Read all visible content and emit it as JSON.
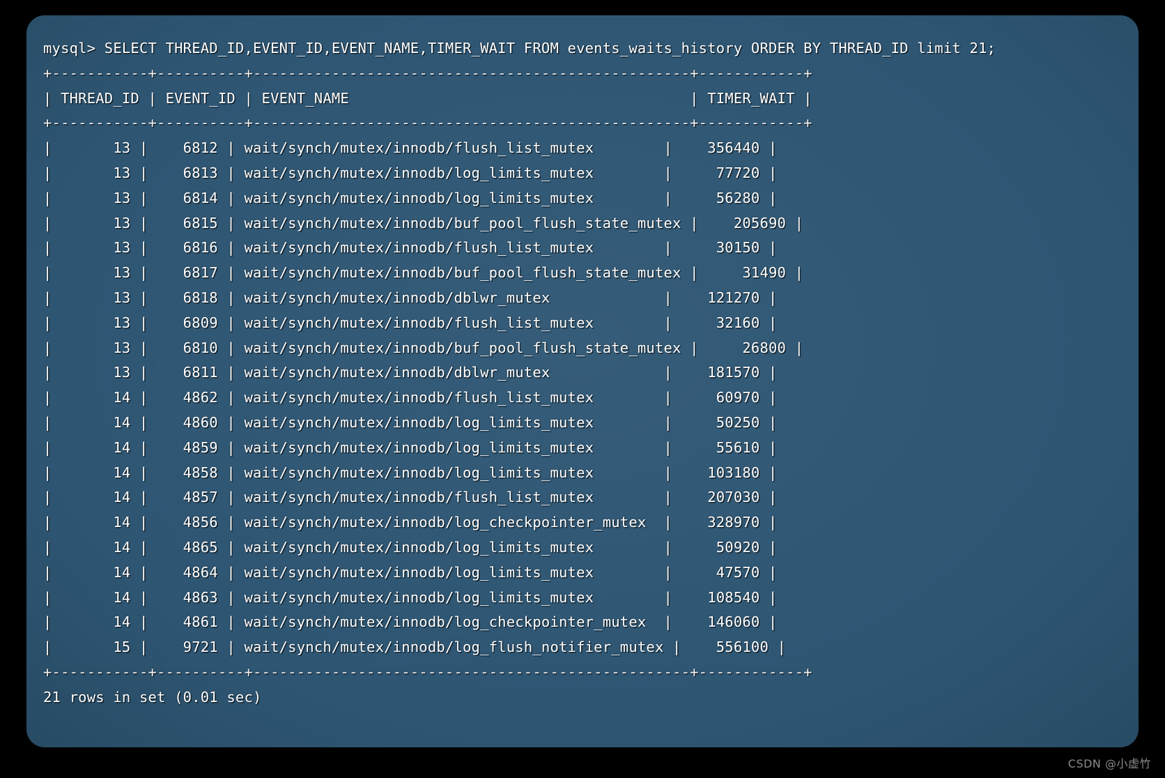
{
  "terminal": {
    "prompt": "mysql> ",
    "command": "SELECT THREAD_ID,EVENT_ID,EVENT_NAME,TIMER_WAIT FROM events_waits_history ORDER BY THREAD_ID limit 21;",
    "prompt_line": "mysql> SELECT THREAD_ID,EVENT_ID,EVENT_NAME,TIMER_WAIT FROM events_waits_history ORDER BY THREAD_ID limit 21;",
    "separator": "+-----------+----------+--------------------------------------------------+------------+",
    "header_line": "| THREAD_ID | EVENT_ID | EVENT_NAME                                       | TIMER_WAIT |",
    "footer_status": "21 rows in set (0.01 sec)",
    "watermark": "CSDN @小虚竹",
    "colors": {
      "background": "#000000",
      "window": "#2e5673",
      "text": "#ffffff",
      "watermark": "#8b8b8b"
    }
  },
  "table": {
    "columns": [
      "THREAD_ID",
      "EVENT_ID",
      "EVENT_NAME",
      "TIMER_WAIT"
    ],
    "rows": [
      {
        "THREAD_ID": "13",
        "EVENT_ID": "6812",
        "EVENT_NAME": "wait/synch/mutex/innodb/flush_list_mutex",
        "TIMER_WAIT": "356440"
      },
      {
        "THREAD_ID": "13",
        "EVENT_ID": "6813",
        "EVENT_NAME": "wait/synch/mutex/innodb/log_limits_mutex",
        "TIMER_WAIT": "77720"
      },
      {
        "THREAD_ID": "13",
        "EVENT_ID": "6814",
        "EVENT_NAME": "wait/synch/mutex/innodb/log_limits_mutex",
        "TIMER_WAIT": "56280"
      },
      {
        "THREAD_ID": "13",
        "EVENT_ID": "6815",
        "EVENT_NAME": "wait/synch/mutex/innodb/buf_pool_flush_state_mutex",
        "TIMER_WAIT": "205690"
      },
      {
        "THREAD_ID": "13",
        "EVENT_ID": "6816",
        "EVENT_NAME": "wait/synch/mutex/innodb/flush_list_mutex",
        "TIMER_WAIT": "30150"
      },
      {
        "THREAD_ID": "13",
        "EVENT_ID": "6817",
        "EVENT_NAME": "wait/synch/mutex/innodb/buf_pool_flush_state_mutex",
        "TIMER_WAIT": "31490"
      },
      {
        "THREAD_ID": "13",
        "EVENT_ID": "6818",
        "EVENT_NAME": "wait/synch/mutex/innodb/dblwr_mutex",
        "TIMER_WAIT": "121270"
      },
      {
        "THREAD_ID": "13",
        "EVENT_ID": "6809",
        "EVENT_NAME": "wait/synch/mutex/innodb/flush_list_mutex",
        "TIMER_WAIT": "32160"
      },
      {
        "THREAD_ID": "13",
        "EVENT_ID": "6810",
        "EVENT_NAME": "wait/synch/mutex/innodb/buf_pool_flush_state_mutex",
        "TIMER_WAIT": "26800"
      },
      {
        "THREAD_ID": "13",
        "EVENT_ID": "6811",
        "EVENT_NAME": "wait/synch/mutex/innodb/dblwr_mutex",
        "TIMER_WAIT": "181570"
      },
      {
        "THREAD_ID": "14",
        "EVENT_ID": "4862",
        "EVENT_NAME": "wait/synch/mutex/innodb/flush_list_mutex",
        "TIMER_WAIT": "60970"
      },
      {
        "THREAD_ID": "14",
        "EVENT_ID": "4860",
        "EVENT_NAME": "wait/synch/mutex/innodb/log_limits_mutex",
        "TIMER_WAIT": "50250"
      },
      {
        "THREAD_ID": "14",
        "EVENT_ID": "4859",
        "EVENT_NAME": "wait/synch/mutex/innodb/log_limits_mutex",
        "TIMER_WAIT": "55610"
      },
      {
        "THREAD_ID": "14",
        "EVENT_ID": "4858",
        "EVENT_NAME": "wait/synch/mutex/innodb/log_limits_mutex",
        "TIMER_WAIT": "103180"
      },
      {
        "THREAD_ID": "14",
        "EVENT_ID": "4857",
        "EVENT_NAME": "wait/synch/mutex/innodb/flush_list_mutex",
        "TIMER_WAIT": "207030"
      },
      {
        "THREAD_ID": "14",
        "EVENT_ID": "4856",
        "EVENT_NAME": "wait/synch/mutex/innodb/log_checkpointer_mutex",
        "TIMER_WAIT": "328970"
      },
      {
        "THREAD_ID": "14",
        "EVENT_ID": "4865",
        "EVENT_NAME": "wait/synch/mutex/innodb/log_limits_mutex",
        "TIMER_WAIT": "50920"
      },
      {
        "THREAD_ID": "14",
        "EVENT_ID": "4864",
        "EVENT_NAME": "wait/synch/mutex/innodb/log_limits_mutex",
        "TIMER_WAIT": "47570"
      },
      {
        "THREAD_ID": "14",
        "EVENT_ID": "4863",
        "EVENT_NAME": "wait/synch/mutex/innodb/log_limits_mutex",
        "TIMER_WAIT": "108540"
      },
      {
        "THREAD_ID": "14",
        "EVENT_ID": "4861",
        "EVENT_NAME": "wait/synch/mutex/innodb/log_checkpointer_mutex",
        "TIMER_WAIT": "146060"
      },
      {
        "THREAD_ID": "15",
        "EVENT_ID": "9721",
        "EVENT_NAME": "wait/synch/mutex/innodb/log_flush_notifier_mutex",
        "TIMER_WAIT": "556100"
      }
    ],
    "widths": {
      "THREAD_ID": 9,
      "EVENT_ID": 8,
      "EVENT_NAME": 48,
      "TIMER_WAIT": 10
    }
  }
}
